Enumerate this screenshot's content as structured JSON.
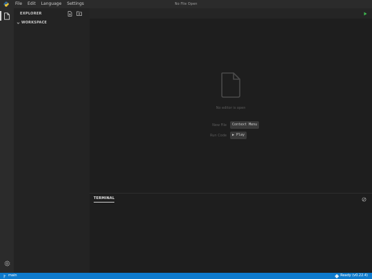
{
  "titlebar": {
    "menu": [
      "File",
      "Edit",
      "Language",
      "Settings"
    ],
    "title": "No File Open"
  },
  "sidebar": {
    "title": "EXPLORER",
    "workspace_label": "WORKSPACE"
  },
  "editor": {
    "empty_message": "No editor is open",
    "hints": [
      {
        "label": "New File",
        "key": "Context Menu"
      },
      {
        "label": "Run Code",
        "key": "▶ Play"
      }
    ]
  },
  "panel": {
    "tab": "TERMINAL"
  },
  "statusbar": {
    "branch": "main",
    "status": "Ready (v0.22.4)"
  },
  "colors": {
    "accent": "#0e7acc",
    "run": "#3fb950",
    "logo_blue": "#3572A5",
    "logo_yellow": "#FFD43B"
  },
  "icons": {
    "logo": "python-logo-icon",
    "explorer": "files-icon",
    "settings": "gear-icon",
    "new_file": "new-file-icon",
    "new_folder": "new-folder-icon",
    "run": "play-icon",
    "terminal_clear": "clear-icon",
    "branch": "git-branch-icon",
    "status": "python-status-icon"
  }
}
